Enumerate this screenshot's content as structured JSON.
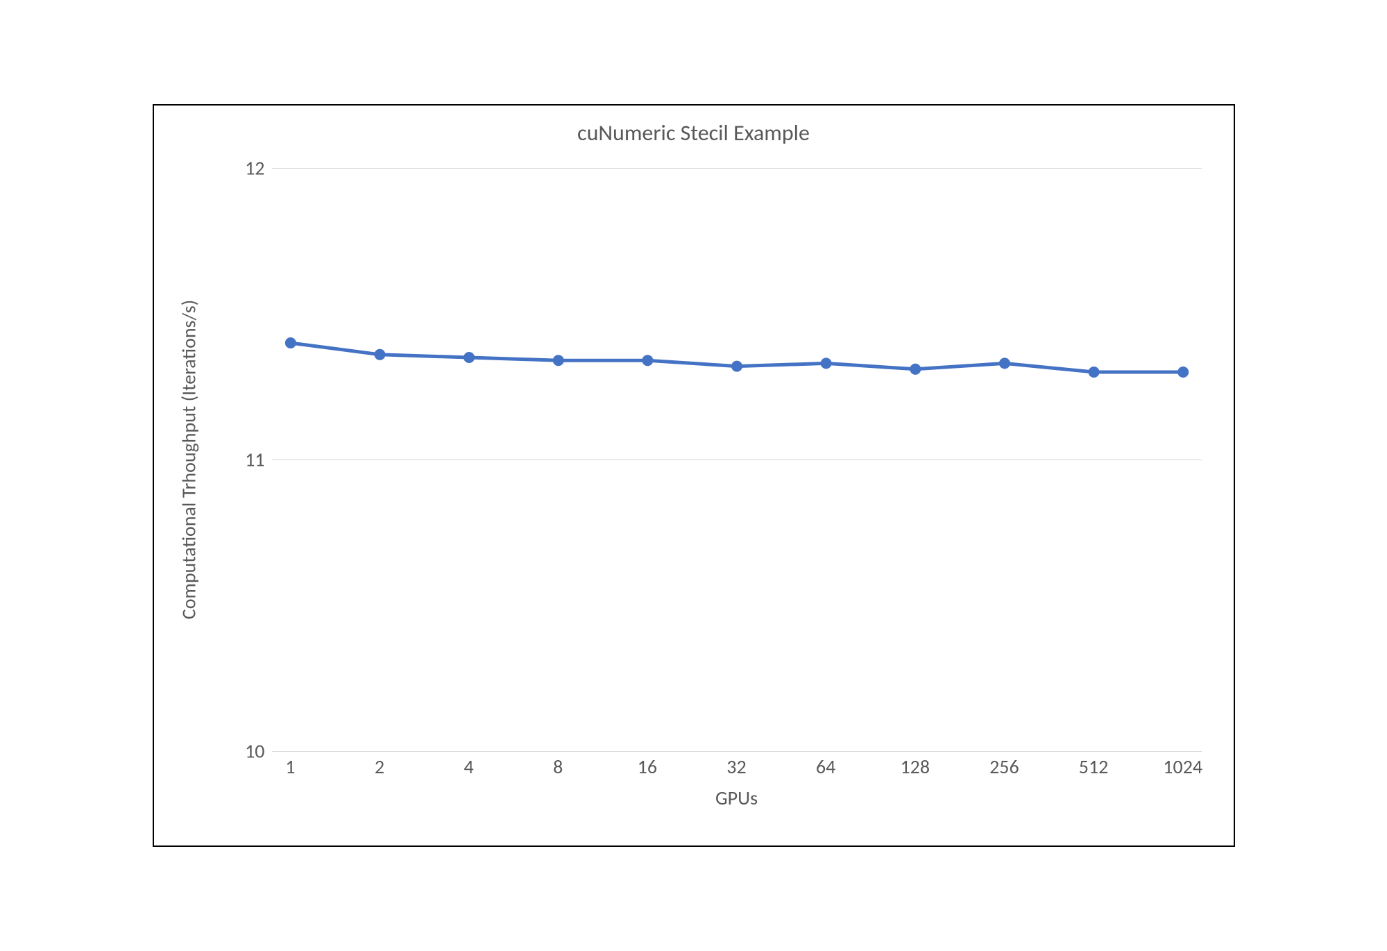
{
  "chart_data": {
    "type": "line",
    "title": "cuNumeric Stecil Example",
    "xlabel": "GPUs",
    "ylabel": "Computational Trhoughput (Iterations/s)",
    "categories": [
      "1",
      "2",
      "4",
      "8",
      "16",
      "32",
      "64",
      "128",
      "256",
      "512",
      "1024"
    ],
    "values": [
      11.4,
      11.36,
      11.35,
      11.34,
      11.34,
      11.32,
      11.33,
      11.31,
      11.33,
      11.3,
      11.3
    ],
    "ylim": [
      10,
      12
    ],
    "yticks": [
      10,
      11,
      12
    ],
    "line_color": "#4472C4"
  }
}
